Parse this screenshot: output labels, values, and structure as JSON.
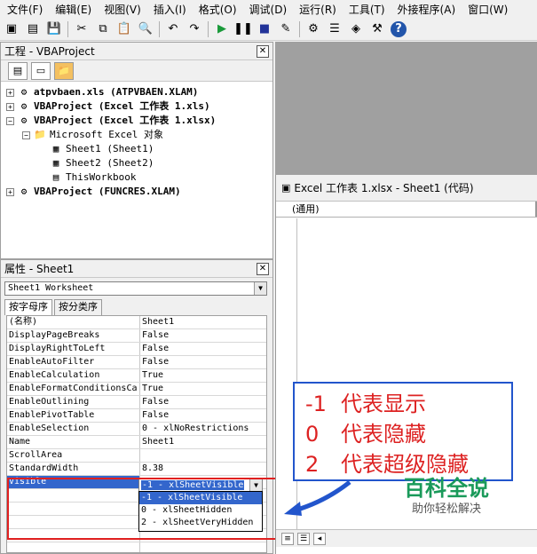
{
  "menubar": [
    "文件(F)",
    "编辑(E)",
    "视图(V)",
    "插入(I)",
    "格式(O)",
    "调试(D)",
    "运行(R)",
    "工具(T)",
    "外接程序(A)",
    "窗口(W)"
  ],
  "toolbar_icons": [
    "excel-icon",
    "insert-module-icon",
    "save-icon",
    "cut-icon",
    "copy-icon",
    "paste-icon",
    "find-icon",
    "undo-icon",
    "redo-icon",
    "run-icon",
    "pause-icon",
    "reset-icon",
    "design-mode-icon",
    "project-explorer-icon",
    "properties-icon",
    "object-browser-icon",
    "toolbox-icon",
    "help-icon"
  ],
  "project": {
    "title": "工程 - VBAProject",
    "tree": [
      {
        "level": 0,
        "exp": "+",
        "icon": "⚙",
        "label": "atpvbaen.xls (ATPVBAEN.XLAM)",
        "bold": true
      },
      {
        "level": 0,
        "exp": "+",
        "icon": "⚙",
        "label": "VBAProject (Excel 工作表 1.xls)",
        "bold": true
      },
      {
        "level": 0,
        "exp": "−",
        "icon": "⚙",
        "label": "VBAProject (Excel 工作表 1.xlsx)",
        "bold": true
      },
      {
        "level": 1,
        "exp": "−",
        "icon": "📁",
        "label": "Microsoft Excel 对象",
        "bold": false
      },
      {
        "level": 2,
        "exp": "",
        "icon": "▦",
        "label": "Sheet1 (Sheet1)",
        "bold": false
      },
      {
        "level": 2,
        "exp": "",
        "icon": "▦",
        "label": "Sheet2 (Sheet2)",
        "bold": false
      },
      {
        "level": 2,
        "exp": "",
        "icon": "▤",
        "label": "ThisWorkbook",
        "bold": false
      },
      {
        "level": 0,
        "exp": "+",
        "icon": "⚙",
        "label": "VBAProject (FUNCRES.XLAM)",
        "bold": true
      }
    ]
  },
  "properties": {
    "title": "属性 - Sheet1",
    "object_select": "Sheet1 Worksheet",
    "tabs": [
      "按字母序",
      "按分类序"
    ],
    "rows": [
      {
        "name": "(名称)",
        "value": "Sheet1"
      },
      {
        "name": "DisplayPageBreaks",
        "value": "False"
      },
      {
        "name": "DisplayRightToLeft",
        "value": "False"
      },
      {
        "name": "EnableAutoFilter",
        "value": "False"
      },
      {
        "name": "EnableCalculation",
        "value": "True"
      },
      {
        "name": "EnableFormatConditionsCa",
        "value": "True"
      },
      {
        "name": "EnableOutlining",
        "value": "False"
      },
      {
        "name": "EnablePivotTable",
        "value": "False"
      },
      {
        "name": "EnableSelection",
        "value": "0 - xlNoRestrictions"
      },
      {
        "name": "Name",
        "value": "Sheet1"
      },
      {
        "name": "ScrollArea",
        "value": ""
      },
      {
        "name": "StandardWidth",
        "value": "8.38"
      },
      {
        "name": "Visible",
        "value": ""
      }
    ],
    "visible_value": "-1 - xlSheetVisible",
    "visible_options": [
      "-1 - xlSheetVisible",
      "0 - xlSheetHidden",
      "2 - xlSheetVeryHidden"
    ]
  },
  "code_window": {
    "title": "Excel 工作表 1.xlsx - Sheet1 (代码)",
    "general": "(通用)"
  },
  "annotation": [
    {
      "num": "-1",
      "text": "代表显示"
    },
    {
      "num": "0",
      "text": "代表隐藏"
    },
    {
      "num": "2",
      "text": "代表超级隐藏"
    }
  ],
  "watermark": {
    "title": "百科全说",
    "subtitle": "助你轻松解决"
  },
  "colors": {
    "annotation_text": "#dd2222",
    "annotation_border": "#2255cc",
    "highlight_box": "#e02020",
    "selection": "#3366cc",
    "watermark": "#1a9a5a"
  }
}
